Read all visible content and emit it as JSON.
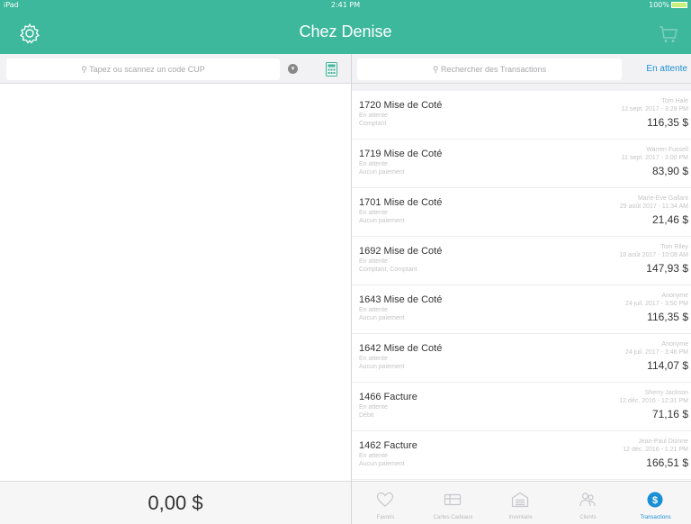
{
  "status_bar": {
    "carrier": "iPad",
    "time": "2:41 PM",
    "battery": "100%"
  },
  "header": {
    "title": "Chez Denise"
  },
  "left": {
    "scan_placeholder": "Tapez ou scannez un code CUP",
    "total": "0,00 $"
  },
  "right": {
    "search_placeholder": "Rechercher des Transactions",
    "filter_label": "En attente"
  },
  "transactions": [
    {
      "title": "1720 Mise de Coté",
      "status": "En attente",
      "payment": "Comptant",
      "customer": "Tom Hale",
      "date": "12 sept. 2017 - 3:29 PM",
      "amount": "116,35 $"
    },
    {
      "title": "1719 Mise de Coté",
      "status": "En attente",
      "payment": "Aucun paiement",
      "customer": "Warren Fussell",
      "date": "11 sept. 2017 - 3:00 PM",
      "amount": "83,90 $"
    },
    {
      "title": "1701 Mise de Coté",
      "status": "En attente",
      "payment": "Aucun paiement",
      "customer": "Marie-Eve Gallant",
      "date": "29 août 2017 - 11:34 AM",
      "amount": "21,46 $"
    },
    {
      "title": "1692 Mise de Coté",
      "status": "En attente",
      "payment": "Comptant, Comptant",
      "customer": "Tom Riley",
      "date": "18 août 2017 - 10:08 AM",
      "amount": "147,93 $"
    },
    {
      "title": "1643 Mise de Coté",
      "status": "En attente",
      "payment": "Aucun paiement",
      "customer": "Anonyme",
      "date": "24 juil. 2017 - 3:50 PM",
      "amount": "116,35 $"
    },
    {
      "title": "1642 Mise de Coté",
      "status": "En attente",
      "payment": "Aucun paiement",
      "customer": "Anonyme",
      "date": "24 juil. 2017 - 3:46 PM",
      "amount": "114,07 $"
    },
    {
      "title": "1466 Facture",
      "status": "En attente",
      "payment": "Débit",
      "customer": "Sherry Jackson",
      "date": "12 déc. 2016 - 12:31 PM",
      "amount": "71,16 $"
    },
    {
      "title": "1462 Facture",
      "status": "En attente",
      "payment": "Aucun paiement",
      "customer": "Jean-Paul Dionne",
      "date": "12 déc. 2016 - 1:21 PM",
      "amount": "166,51 $"
    }
  ],
  "tabs": [
    {
      "label": "Favoris",
      "icon": "heart-icon"
    },
    {
      "label": "Cartes-Cadeaux",
      "icon": "gift-card-icon"
    },
    {
      "label": "Inventaire",
      "icon": "inventory-icon"
    },
    {
      "label": "Clients",
      "icon": "clients-icon"
    },
    {
      "label": "Transactions",
      "icon": "transactions-icon",
      "active": true
    }
  ],
  "colors": {
    "header": "#3db89c",
    "accent": "#1a8fd6"
  }
}
